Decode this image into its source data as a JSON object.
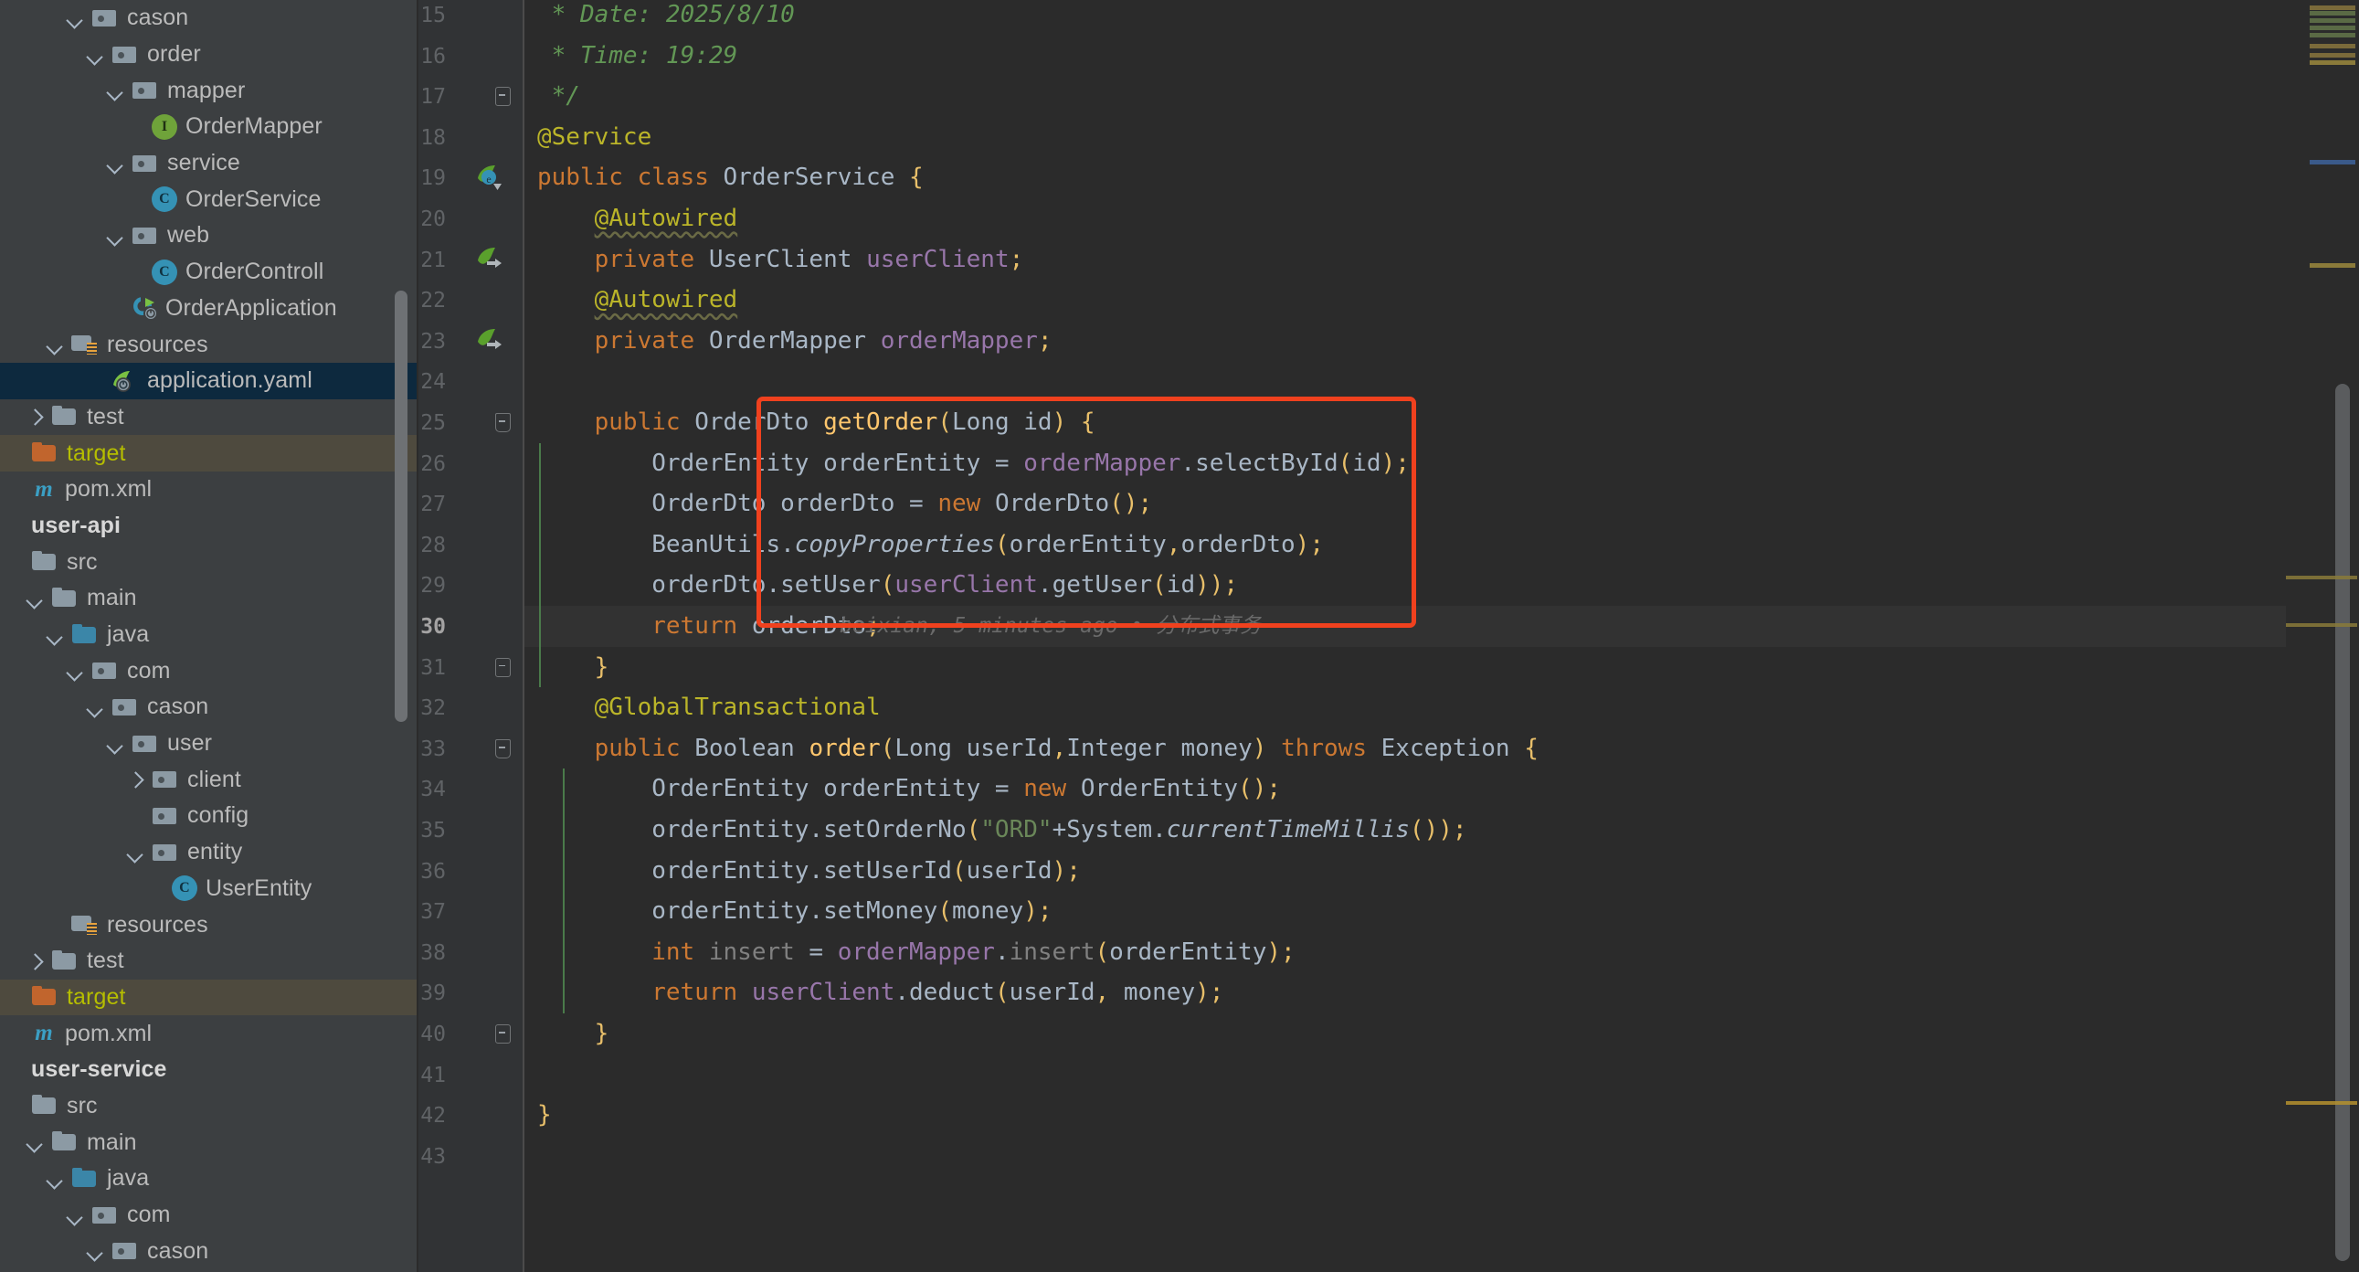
{
  "sidebar": {
    "scrollbar": "project-tree-scrollbar",
    "items": [
      {
        "depth": 3,
        "arrow": "down",
        "icon": "package-folder",
        "label": "cason",
        "state": "normal"
      },
      {
        "depth": 4,
        "arrow": "down",
        "icon": "package-folder",
        "label": "order",
        "state": "normal"
      },
      {
        "depth": 5,
        "arrow": "down",
        "icon": "package-folder",
        "label": "mapper",
        "state": "normal"
      },
      {
        "depth": 6,
        "arrow": "none",
        "icon": "interface-badge",
        "label": "OrderMapper",
        "state": "normal"
      },
      {
        "depth": 5,
        "arrow": "down",
        "icon": "package-folder",
        "label": "service",
        "state": "normal"
      },
      {
        "depth": 6,
        "arrow": "none",
        "icon": "class-badge",
        "label": "OrderService",
        "state": "normal"
      },
      {
        "depth": 5,
        "arrow": "down",
        "icon": "package-folder",
        "label": "web",
        "state": "normal"
      },
      {
        "depth": 6,
        "arrow": "none",
        "icon": "class-badge",
        "label": "OrderControll",
        "state": "normal"
      },
      {
        "depth": 5,
        "arrow": "none",
        "icon": "spring-app-icon",
        "label": "OrderApplication",
        "state": "normal"
      },
      {
        "depth": 2,
        "arrow": "down",
        "icon": "resources-folder",
        "label": "resources",
        "state": "normal"
      },
      {
        "depth": 4,
        "arrow": "none",
        "icon": "yaml-spring-icon",
        "label": "application.yaml",
        "state": "selected"
      },
      {
        "depth": 1,
        "arrow": "right",
        "icon": "folder",
        "label": "test",
        "state": "normal"
      },
      {
        "depth": 0,
        "arrow": "none",
        "icon": "excluded-folder",
        "label": "target",
        "state": "excluded"
      },
      {
        "depth": 0,
        "arrow": "none",
        "icon": "maven-icon",
        "label": "pom.xml",
        "state": "normal"
      },
      {
        "depth": 0,
        "arrow": "none",
        "icon": "none",
        "label": "user-api",
        "state": "module"
      },
      {
        "depth": 0,
        "arrow": "none",
        "icon": "folder",
        "label": "src",
        "state": "normal"
      },
      {
        "depth": 1,
        "arrow": "down",
        "icon": "folder",
        "label": "main",
        "state": "normal"
      },
      {
        "depth": 2,
        "arrow": "down",
        "icon": "source-folder",
        "label": "java",
        "state": "normal"
      },
      {
        "depth": 3,
        "arrow": "down",
        "icon": "package-folder",
        "label": "com",
        "state": "normal"
      },
      {
        "depth": 4,
        "arrow": "down",
        "icon": "package-folder",
        "label": "cason",
        "state": "normal"
      },
      {
        "depth": 5,
        "arrow": "down",
        "icon": "package-folder",
        "label": "user",
        "state": "normal"
      },
      {
        "depth": 6,
        "arrow": "right",
        "icon": "package-folder",
        "label": "client",
        "state": "normal"
      },
      {
        "depth": 6,
        "arrow": "none",
        "icon": "package-folder",
        "label": "config",
        "state": "normal"
      },
      {
        "depth": 6,
        "arrow": "down",
        "icon": "package-folder",
        "label": "entity",
        "state": "normal"
      },
      {
        "depth": 7,
        "arrow": "none",
        "icon": "class-badge",
        "label": "UserEntity",
        "state": "normal"
      },
      {
        "depth": 2,
        "arrow": "none",
        "icon": "resources-folder",
        "label": "resources",
        "state": "normal"
      },
      {
        "depth": 1,
        "arrow": "right",
        "icon": "folder",
        "label": "test",
        "state": "normal"
      },
      {
        "depth": 0,
        "arrow": "none",
        "icon": "excluded-folder",
        "label": "target",
        "state": "excluded"
      },
      {
        "depth": 0,
        "arrow": "none",
        "icon": "maven-icon",
        "label": "pom.xml",
        "state": "normal"
      },
      {
        "depth": 0,
        "arrow": "none",
        "icon": "none",
        "label": "user-service",
        "state": "module"
      },
      {
        "depth": 0,
        "arrow": "none",
        "icon": "folder",
        "label": "src",
        "state": "normal"
      },
      {
        "depth": 1,
        "arrow": "down",
        "icon": "folder",
        "label": "main",
        "state": "normal"
      },
      {
        "depth": 2,
        "arrow": "down",
        "icon": "source-folder",
        "label": "java",
        "state": "normal"
      },
      {
        "depth": 3,
        "arrow": "down",
        "icon": "package-folder",
        "label": "com",
        "state": "normal"
      },
      {
        "depth": 4,
        "arrow": "down",
        "icon": "package-folder",
        "label": "cason",
        "state": "normal"
      }
    ]
  },
  "editor": {
    "file": "OrderService.java",
    "inlay_hint": "beixian, 5 minutes ago • 分布式事务",
    "highlight_color": "#f0411e",
    "current_line": 30,
    "lines": [
      {
        "n": 15,
        "gutter": "",
        "fold": ""
      },
      {
        "n": 16,
        "gutter": "",
        "fold": ""
      },
      {
        "n": 17,
        "gutter": "",
        "fold": "end"
      },
      {
        "n": 18,
        "gutter": "",
        "fold": ""
      },
      {
        "n": 19,
        "gutter": "spring-bean-icon",
        "fold": ""
      },
      {
        "n": 20,
        "gutter": "",
        "fold": ""
      },
      {
        "n": 21,
        "gutter": "spring-autowire-icon",
        "fold": ""
      },
      {
        "n": 22,
        "gutter": "",
        "fold": ""
      },
      {
        "n": 23,
        "gutter": "spring-autowire-icon",
        "fold": ""
      },
      {
        "n": 24,
        "gutter": "",
        "fold": ""
      },
      {
        "n": 25,
        "gutter": "",
        "fold": "start"
      },
      {
        "n": 26,
        "gutter": "",
        "fold": ""
      },
      {
        "n": 27,
        "gutter": "",
        "fold": ""
      },
      {
        "n": 28,
        "gutter": "",
        "fold": ""
      },
      {
        "n": 29,
        "gutter": "",
        "fold": ""
      },
      {
        "n": 30,
        "gutter": "",
        "fold": ""
      },
      {
        "n": 31,
        "gutter": "",
        "fold": "end"
      },
      {
        "n": 32,
        "gutter": "",
        "fold": ""
      },
      {
        "n": 33,
        "gutter": "",
        "fold": "start"
      },
      {
        "n": 34,
        "gutter": "",
        "fold": ""
      },
      {
        "n": 35,
        "gutter": "",
        "fold": ""
      },
      {
        "n": 36,
        "gutter": "",
        "fold": ""
      },
      {
        "n": 37,
        "gutter": "",
        "fold": ""
      },
      {
        "n": 38,
        "gutter": "",
        "fold": ""
      },
      {
        "n": 39,
        "gutter": "",
        "fold": ""
      },
      {
        "n": 40,
        "gutter": "",
        "fold": "end"
      },
      {
        "n": 41,
        "gutter": "",
        "fold": ""
      },
      {
        "n": 42,
        "gutter": "",
        "fold": ""
      },
      {
        "n": 43,
        "gutter": "",
        "fold": ""
      }
    ],
    "source_text": [
      " * Date: 2025/8/10",
      " * Time: 19:29",
      " */",
      "@Service",
      "public class OrderService {",
      "    @Autowired",
      "    private UserClient userClient;",
      "    @Autowired",
      "    private OrderMapper orderMapper;",
      "",
      "    public OrderDto getOrder(Long id) {",
      "        OrderEntity orderEntity = orderMapper.selectById(id);",
      "        OrderDto orderDto = new OrderDto();",
      "        BeanUtils.copyProperties(orderEntity,orderDto);",
      "        orderDto.setUser(userClient.getUser(id));",
      "        return orderDto;",
      "    }",
      "    @GlobalTransactional",
      "    public Boolean order(Long userId,Integer money) throws Exception {",
      "        OrderEntity orderEntity = new OrderEntity();",
      "        orderEntity.setOrderNo(\"ORD\"+System.currentTimeMillis());",
      "        orderEntity.setUserId(userId);",
      "        orderEntity.setMoney(money);",
      "        int insert = orderMapper.insert(orderEntity);",
      "        return userClient.deduct(userId, money);",
      "    }",
      "",
      "}",
      ""
    ]
  }
}
